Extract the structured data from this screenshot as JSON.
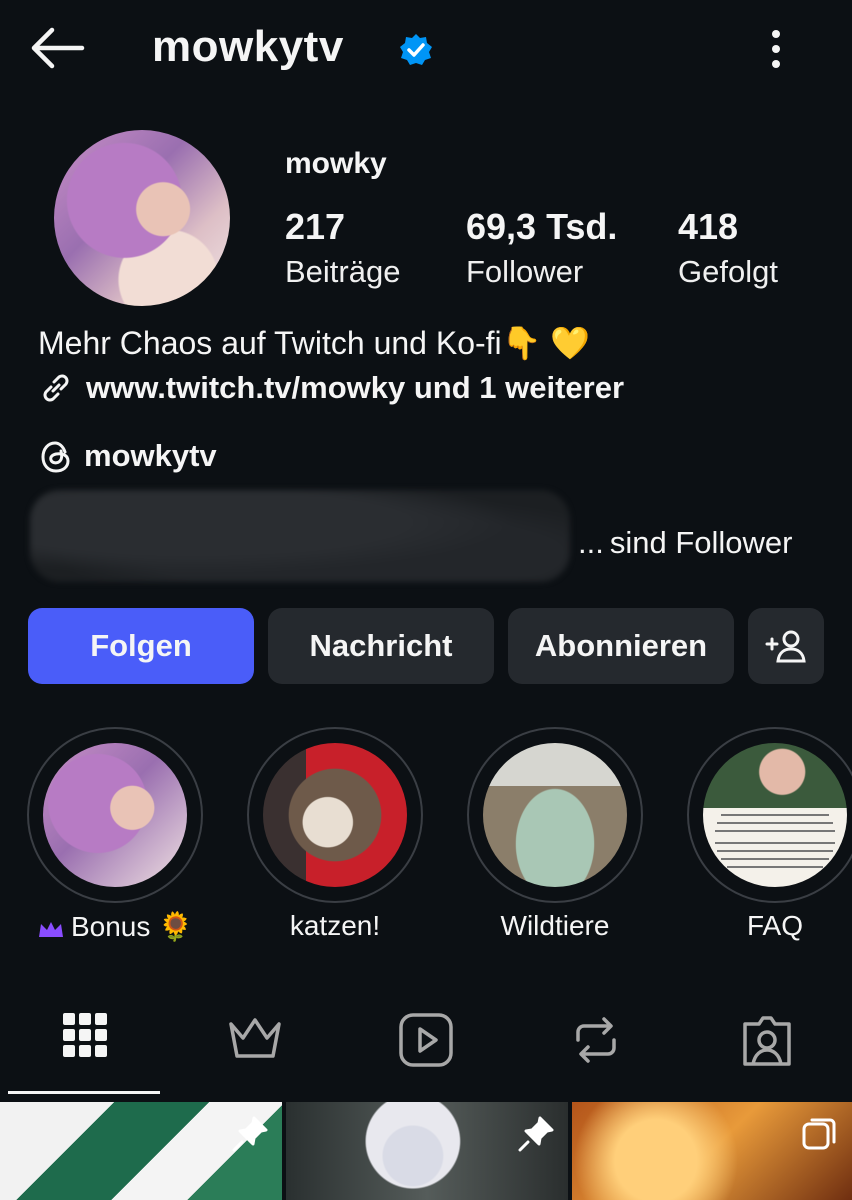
{
  "header": {
    "title": "mowkytv"
  },
  "profile": {
    "name": "mowky",
    "stats": [
      {
        "value": "217",
        "label": "Beiträge"
      },
      {
        "value": "69,3 Tsd.",
        "label": "Follower"
      },
      {
        "value": "418",
        "label": "Gefolgt"
      }
    ],
    "bio": "Mehr Chaos auf Twitch und Ko-fi👇 💛",
    "link": "www.twitch.tv/mowky und 1 weiterer",
    "threads": "mowkytv",
    "followed_by": "sind Follower",
    "followed_by_prefix": "..."
  },
  "actions": {
    "follow": "Folgen",
    "message": "Nachricht",
    "subscribe": "Abonnieren"
  },
  "highlights": [
    {
      "label": "Bonus 🌻"
    },
    {
      "label": "katzen!"
    },
    {
      "label": "Wildtiere"
    },
    {
      "label": "FAQ"
    }
  ],
  "colors": {
    "background": "#0c1014",
    "primary_button": "#4a5df9",
    "secondary_button": "#25292e",
    "verified": "#0095f6",
    "crown": "#8a4dff"
  },
  "icons": {
    "back": "arrow-left-icon",
    "verified": "verified-badge-icon",
    "more": "more-vertical-icon",
    "link": "link-icon",
    "threads": "threads-icon",
    "add_person": "add-person-icon",
    "tabs": [
      "grid-icon",
      "crown-icon",
      "reels-icon",
      "reposts-icon",
      "tagged-icon"
    ]
  }
}
